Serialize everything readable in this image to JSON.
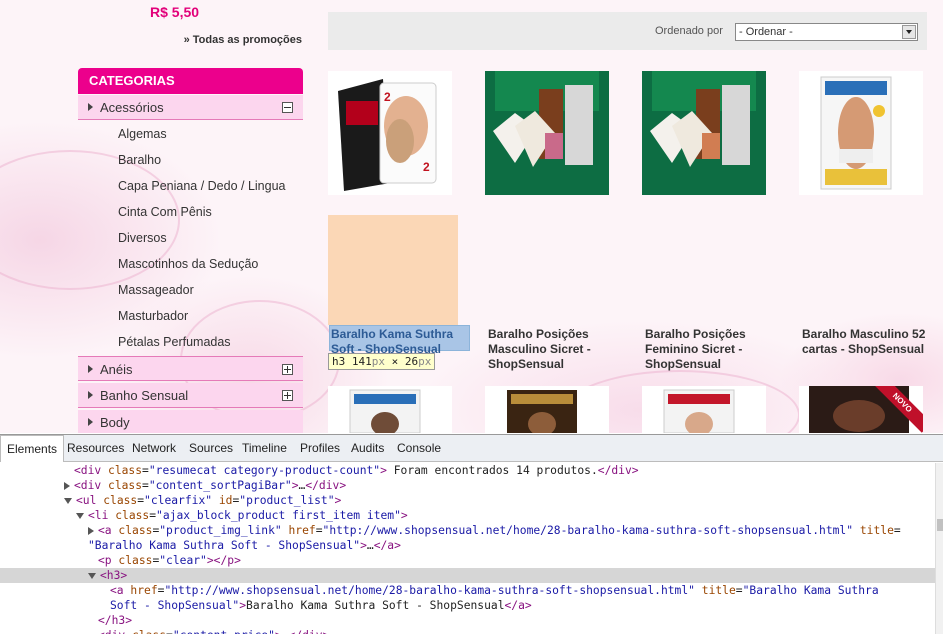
{
  "page": {
    "price": "R$ 5,50",
    "promo_link": "» Todas as promoções",
    "categories": {
      "header": "CATEGORIAS",
      "expanded": {
        "label": "Acessórios",
        "toggle": "minus"
      },
      "subitems": [
        "Algemas",
        "Baralho",
        "Capa Peniana / Dedo / Lingua",
        "Cinta Com Pênis",
        "Diversos",
        "Mascotinhos da Sedução",
        "Massageador",
        "Masturbador",
        "Pétalas Perfumadas"
      ],
      "collapsed": [
        {
          "label": "Anéis",
          "toggle": "plus"
        },
        {
          "label": "Banho Sensual",
          "toggle": "plus"
        },
        {
          "label": "Body",
          "toggle": "none"
        }
      ]
    },
    "sort": {
      "label": "Ordenado por",
      "selected": "- Ordenar -"
    },
    "products_row1_titles": [
      "Baralho Kama Suthra Soft - ShopSensual",
      "Baralho Posições Masculino Sicret - ShopSensual",
      "Baralho Posições Feminino Sicret - ShopSensual",
      "Baralho Masculino 52 cartas - ShopSensual"
    ],
    "ribbon": "NOVO",
    "inspect_tooltip": {
      "tag": "h3",
      "width": "141",
      "height": "26",
      "unit": "px",
      "sep": "×"
    }
  },
  "devtools": {
    "tabs": [
      "Elements",
      "Resources",
      "Network",
      "Sources",
      "Timeline",
      "Profiles",
      "Audits",
      "Console"
    ],
    "active_tab": "Elements"
  },
  "colors": {
    "accent": "#ec008c",
    "price": "#e2007a",
    "category_row": "#fcd6ee"
  }
}
